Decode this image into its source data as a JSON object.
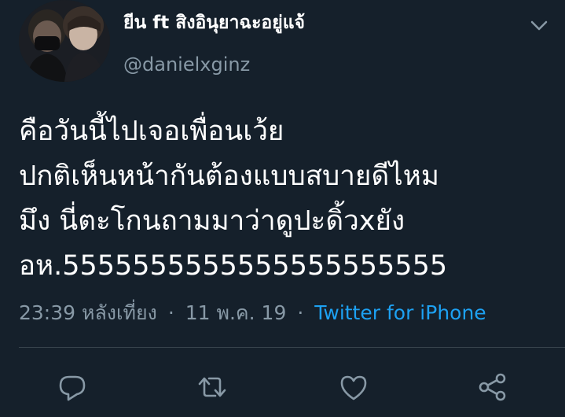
{
  "tweet": {
    "author": {
      "display_name": "ยีน ft สิงอินุยาฉะอยู่แจ้",
      "handle": "@danielxginz",
      "avatar_icon": "profile-photo"
    },
    "text_lines": [
      "คือวันนี้ไปเจอเพื่อนเว้ย",
      "ปกติเห็นหน้ากันต้องแบบสบายดีไหม",
      "มึง นี่ตะโกนถามมาว่าดูปะดิ้วxยัง",
      "อห.5555555555555555555555"
    ],
    "time": "23:39 หลังเที่ยง",
    "date": "11 พ.ค. 19",
    "separator": "·",
    "source": "Twitter for iPhone"
  },
  "menu": {
    "icon": "chevron-down-icon"
  },
  "actions": [
    {
      "name": "reply",
      "icon": "reply-icon"
    },
    {
      "name": "retweet",
      "icon": "retweet-icon"
    },
    {
      "name": "like",
      "icon": "heart-icon"
    },
    {
      "name": "share",
      "icon": "share-icon"
    }
  ],
  "colors": {
    "background": "#15202b",
    "text": "#ffffff",
    "secondary": "#8899a6",
    "accent": "#1da1f2",
    "divider": "#38444d"
  }
}
